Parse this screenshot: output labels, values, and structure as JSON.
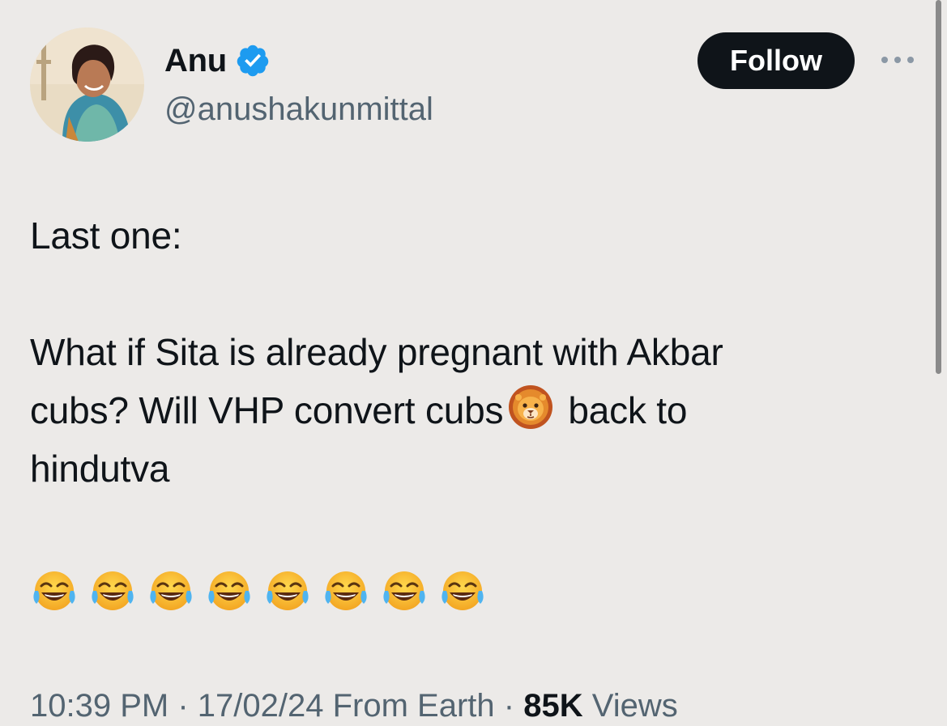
{
  "author": {
    "display_name": "Anu",
    "handle": "@anushakunmittal",
    "avatar_icon": "profile-photo",
    "verified_icon": "verified-badge-icon",
    "verified_color": "#1d9bf0"
  },
  "actions": {
    "follow_label": "Follow",
    "more_icon": "more-options-icon"
  },
  "tweet": {
    "line_1": "Last one:",
    "line_2": "What if Sita is already pregnant with Akbar",
    "line_3_before_emoji": "cubs? Will VHP convert cubs",
    "line_3_emoji": "lion-face-emoji",
    "line_3_after_emoji": "back to",
    "line_4": "hindutva",
    "emoji_row": [
      "face-with-tears-of-joy",
      "face-with-tears-of-joy",
      "face-with-tears-of-joy",
      "face-with-tears-of-joy",
      "face-with-tears-of-joy",
      "face-with-tears-of-joy",
      "face-with-tears-of-joy",
      "face-with-tears-of-joy"
    ]
  },
  "meta": {
    "time": "10:39 PM",
    "separator": "·",
    "date": "17/02/24",
    "source": "From Earth",
    "views_count": "85K",
    "views_label": "Views"
  },
  "colors": {
    "background": "#ECEAE8",
    "text": "#0f1419",
    "secondary_text": "#536471",
    "follow_button": "#0f1419"
  }
}
